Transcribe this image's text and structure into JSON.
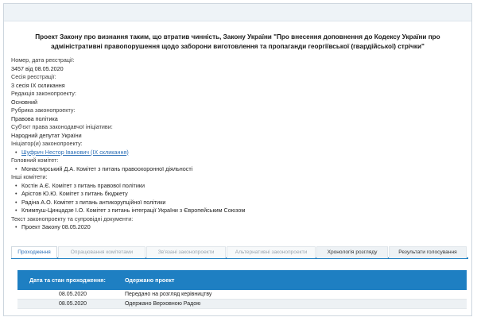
{
  "bill": {
    "title": "Проект Закону про визнання таким, що втратив чинність, Закону України \"Про внесення доповнення до Кодексу України про адміністративні правопорушення щодо заборони виготовлення та пропаганди георгіївської (гвардійської) стрічки\""
  },
  "info": {
    "number_label": "Номер, дата реєстрації:",
    "number_value": "3457 від 08.05.2020",
    "session_label": "Сесія реєстрації:",
    "session_value": "3 сесія IX скликання",
    "edition_label": "Редакція законопроекту:",
    "edition_value": "Основний",
    "rubric_label": "Рубрика законопроекту:",
    "rubric_value": "Правова політика",
    "subject_label": "Суб'єкт права законодавчої ініціативи:",
    "subject_value": "Народний депутат України",
    "initiator_label": "Ініціатор(и) законопроекту:",
    "initiator_value": "Шуфрич Нестор Іванович (IX скликання)",
    "main_committee_label": "Головний комітет:",
    "main_committee_value": "Монастирський Д.А. Комітет з питань правоохоронної діяльності",
    "other_committees_label": "Інші комітети:",
    "other_committees": [
      "Костін А.Є. Комітет з питань правової політики",
      "Арістов Ю.Ю. Комітет з питань бюджету",
      "Радіна А.О. Комітет з питань антикорупційної політики",
      "Климпуш-Цинцадзе І.О. Комітет з питань інтеграції України з Європейським Союзом"
    ],
    "docs_label": "Текст законопроекту та супровідні документи:",
    "docs_value": "Проект Закону 08.05.2020"
  },
  "tabs": [
    "Проходження",
    "Опрацювання комітетами",
    "Зв'язані законопроекти",
    "Альтернативні законопроекти",
    "Хронологія розгляду",
    "Результати голосування"
  ],
  "table": {
    "col1": "Дата та стан проходження:",
    "col2": "Одержано проект",
    "rows": [
      {
        "date": "08.05.2020",
        "status": "Передано на розгляд керівництву"
      },
      {
        "date": "08.05.2020",
        "status": "Одержано Верховною Радою"
      }
    ]
  }
}
